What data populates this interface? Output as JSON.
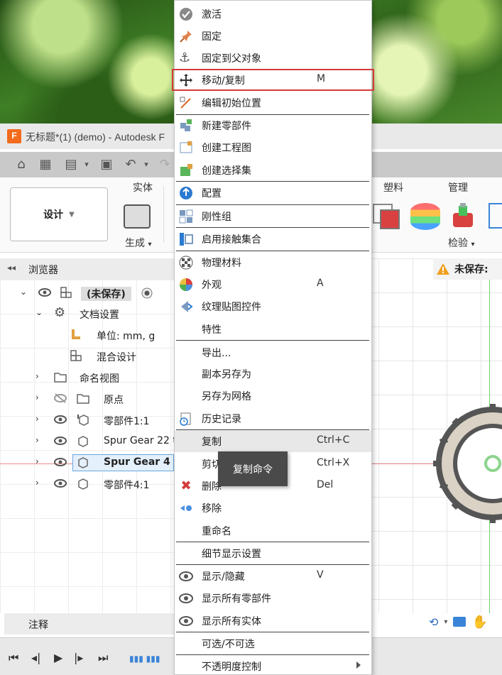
{
  "window": {
    "app_letter": "F",
    "title": "无标题*(1) (demo) - Autodesk F"
  },
  "ribbon": {
    "workspace": "设计",
    "tabs": {
      "solid": "实体",
      "plastic": "塑料",
      "manage": "管理"
    },
    "create_label": "生成",
    "inspect_label": "检验"
  },
  "browser": {
    "title": "浏览器",
    "root_label": "(未保存)",
    "doc_settings": "文档设置",
    "units": "单位: mm, g",
    "hybrid_design": "混合设计",
    "named_views": "命名视图",
    "origin": "原点",
    "components": [
      "零部件1:1",
      "Spur Gear 22 t",
      "Spur Gear 4 te",
      "零部件4:1"
    ]
  },
  "canvas": {
    "unsaved_badge": "未保存:"
  },
  "annotation": {
    "label": "注释"
  },
  "context_menu": {
    "items": [
      {
        "label": "激活",
        "icon": "checkmark-icon"
      },
      {
        "label": "固定",
        "icon": "pin-icon"
      },
      {
        "label": "固定到父对象",
        "icon": "anchor-icon"
      },
      {
        "label": "移动/复制",
        "key": "M",
        "icon": "move-icon"
      },
      {
        "label": "编辑初始位置",
        "icon": "edit-position-icon"
      },
      {
        "label": "新建零部件",
        "icon": "new-component-icon"
      },
      {
        "label": "创建工程图",
        "icon": "drawing-icon"
      },
      {
        "label": "创建选择集",
        "icon": "selection-set-icon"
      },
      {
        "label": "配置",
        "icon": "configure-icon"
      },
      {
        "label": "刚性组",
        "icon": "rigid-group-icon"
      },
      {
        "label": "启用接触集合",
        "icon": "contact-set-icon"
      },
      {
        "label": "物理材料",
        "icon": "material-icon"
      },
      {
        "label": "外观",
        "key": "A",
        "icon": "appearance-icon"
      },
      {
        "label": "纹理贴图控件",
        "icon": "texture-icon"
      },
      {
        "label": "特性",
        "icon": ""
      },
      {
        "label": "导出...",
        "icon": ""
      },
      {
        "label": "副本另存为",
        "icon": ""
      },
      {
        "label": "另存为网格",
        "icon": ""
      },
      {
        "label": "历史记录",
        "icon": "history-icon"
      },
      {
        "label": "复制",
        "key": "Ctrl+C",
        "icon": ""
      },
      {
        "label": "剪切",
        "key": "Ctrl+X",
        "icon": ""
      },
      {
        "label": "删除",
        "key": "Del",
        "icon": "delete-icon"
      },
      {
        "label": "移除",
        "icon": "remove-icon"
      },
      {
        "label": "重命名",
        "icon": ""
      },
      {
        "label": "细节显示设置",
        "icon": ""
      },
      {
        "label": "显示/隐藏",
        "key": "V",
        "icon": "eye-icon"
      },
      {
        "label": "显示所有零部件",
        "icon": "eye-icon"
      },
      {
        "label": "显示所有实体",
        "icon": "eye-icon"
      },
      {
        "label": "可选/不可选",
        "icon": ""
      },
      {
        "label": "不透明度控制",
        "icon": ""
      }
    ]
  },
  "tooltip": {
    "text": "复制命令"
  },
  "colors": {
    "highlight_outline": "#d43a3a",
    "accent_blue": "#3a84d8",
    "brand_orange": "#f26b1d"
  }
}
